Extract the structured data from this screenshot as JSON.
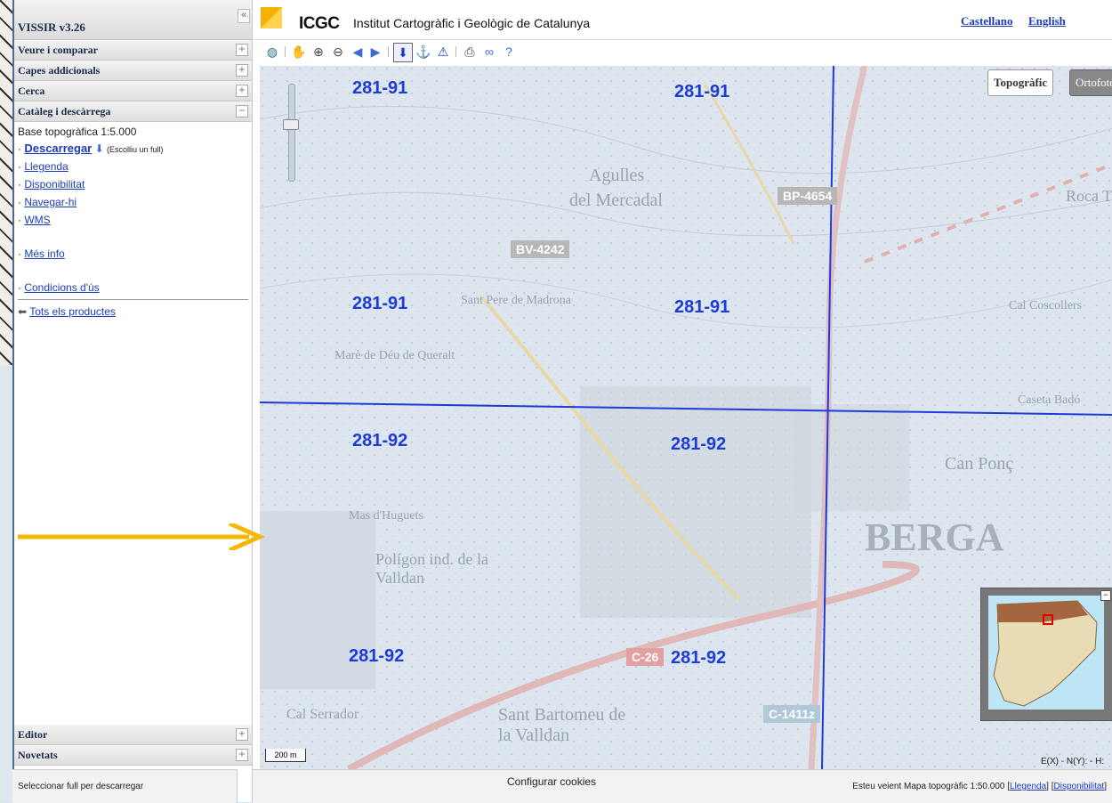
{
  "sidebar": {
    "title": "VISSIR v3.26",
    "sections": [
      {
        "label": "Veure i comparar",
        "toggle": "+"
      },
      {
        "label": "Capes addicionals",
        "toggle": "+"
      },
      {
        "label": "Cerca",
        "toggle": "+"
      },
      {
        "label": "Catàleg i descàrrega",
        "toggle": "−"
      }
    ],
    "catalog": {
      "product_title": "Base topogràfica 1:5.000",
      "download_label": "Descarregar",
      "download_hint": "(Escolliu un full)",
      "links": [
        "Llegenda",
        "Disponibilitat",
        "Navegar-hi",
        "WMS"
      ],
      "more_info": "Més info",
      "terms": "Condicions d'ús",
      "all_products": "Tots els productes"
    },
    "bottom_sections": [
      {
        "label": "Editor",
        "toggle": "+"
      },
      {
        "label": "Novetats",
        "toggle": "+"
      }
    ]
  },
  "header": {
    "logo": "ICGC",
    "org_name": "Institut Cartogràfic i Geològic de Catalunya",
    "lang_es": "Castellano",
    "lang_en": "English"
  },
  "map": {
    "base_buttons": {
      "topo": "Topogràfic",
      "orto": "Ortofoto"
    },
    "sheet_labels": [
      "281-91",
      "281-91",
      "281-91",
      "281-91",
      "281-92",
      "281-92",
      "281-92",
      "281-92"
    ],
    "places": [
      "Agulles",
      "del Mercadal",
      "Sant Pere de Madrona",
      "Marè de Déu de Queralt",
      "BERGA",
      "Can Ponç",
      "Mas d'Huguets",
      "Polígon ind. de la Valldan",
      "Cal Serrador",
      "Sant Bartomeu de la Valldan",
      "Caseta Badó",
      "Cal Coscollers",
      "Roca T"
    ],
    "roads": [
      "BV-4242",
      "BP-4654",
      "C-26",
      "C-1411z"
    ],
    "scale": "200 m",
    "coords": "E(X) - N(Y): - H:"
  },
  "status": {
    "left": "Seleccionar full per descarregar",
    "cookies": "Configurar cookies",
    "right_prefix": "Esteu veient Mapa topogràfic 1:50.000",
    "legend_link": "Llegenda",
    "availability_link": "Disponibilitat"
  },
  "colors": {
    "accent": "#1a3cb8",
    "grid_line": "#1e3bd8",
    "annotation_arrow": "#f5b800",
    "logo": "#f7b000"
  }
}
